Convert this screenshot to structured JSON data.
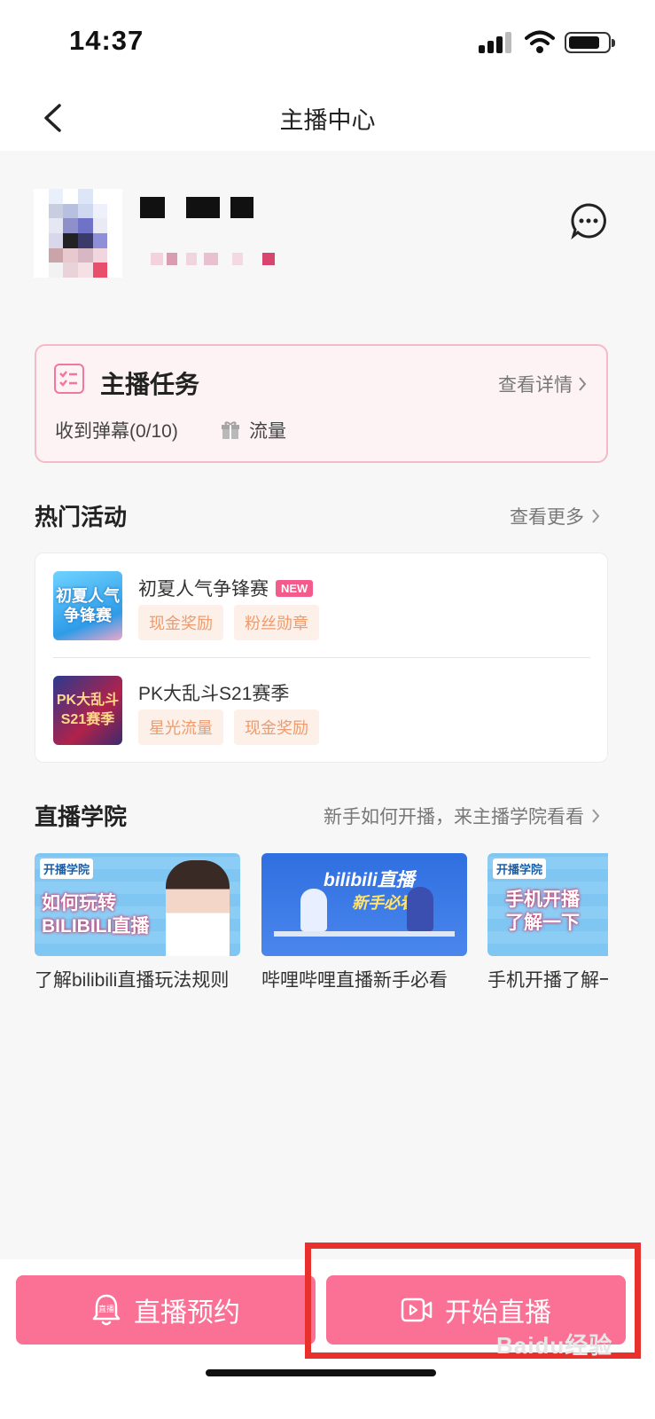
{
  "status_bar": {
    "time": "14:37"
  },
  "nav": {
    "title": "主播中心"
  },
  "task": {
    "title": "主播任务",
    "detail_link": "查看详情",
    "progress": "收到弹幕(0/10)",
    "reward": "流量"
  },
  "hot_events": {
    "title": "热门活动",
    "more_link": "查看更多",
    "items": [
      {
        "thumb_text": "初夏人气争锋赛",
        "name": "初夏人气争锋赛",
        "badge": "NEW",
        "tags": [
          "现金奖励",
          "粉丝勋章"
        ]
      },
      {
        "thumb_text": "PK大乱斗S21赛季",
        "name": "PK大乱斗S21赛季",
        "tags": [
          "星光流量",
          "现金奖励"
        ]
      }
    ]
  },
  "academy": {
    "title": "直播学院",
    "more_link": "新手如何开播，来主播学院看看",
    "items": [
      {
        "thumb_top": "开播学院",
        "thumb_text": "如何玩转 BILIBILI直播",
        "caption": "了解bilibili直播玩法规则"
      },
      {
        "thumb_top": "bilibili直播",
        "thumb_text": "新手必看",
        "caption": "哔哩哔哩直播新手必看"
      },
      {
        "thumb_top": "开播学院",
        "thumb_text": "手机开播 了解一下",
        "caption": "手机开播了解一下"
      }
    ]
  },
  "bottom": {
    "reserve_label": "直播预约",
    "reserve_icon_text": "直播",
    "start_label": "开始直播"
  },
  "watermark": "Baidu经验",
  "colors": {
    "accent": "#fb7196",
    "highlight": "#e8312d",
    "tag_text": "#ee9b6e",
    "badge": "#f35b8b"
  }
}
